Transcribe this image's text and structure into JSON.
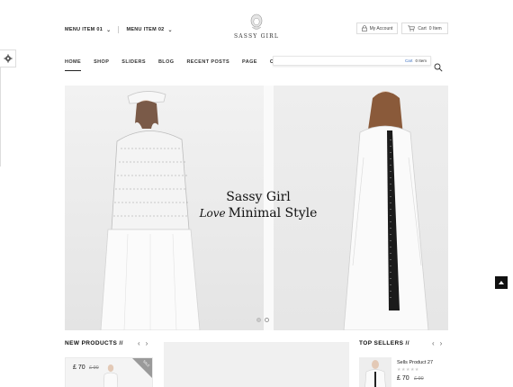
{
  "header": {
    "menu_items": [
      {
        "label": "MENU ITEM 01"
      },
      {
        "label": "MENU ITEM 02"
      }
    ],
    "logo_text": "SASSY GIRL",
    "account_label": "My Account",
    "cart_label": "Cart",
    "cart_count": "0 Item"
  },
  "nav": {
    "links": [
      {
        "label": "HOME",
        "active": true
      },
      {
        "label": "SHOP"
      },
      {
        "label": "SLIDERS"
      },
      {
        "label": "BLOG"
      },
      {
        "label": "RECENT POSTS"
      },
      {
        "label": "PAGE"
      },
      {
        "label": "CONTACT US"
      }
    ],
    "cart_dropdown": {
      "cart_word": "Cart",
      "count": "0 Item"
    }
  },
  "hero": {
    "line1": "Sassy Girl",
    "love": "Love",
    "line2": "Minimal Style",
    "slide_count": 2,
    "active_slide": 2
  },
  "new_products": {
    "title": "NEW PRODUCTS //",
    "items": [
      {
        "price": "£ 70",
        "old_price": "£ 90",
        "badge": "SALE"
      }
    ]
  },
  "top_sellers": {
    "title": "TOP SELLERS //",
    "items": [
      {
        "name": "Sells Product 27",
        "price": "£ 70",
        "old_price": "£ 90",
        "rating": 0
      }
    ]
  },
  "colors": {
    "accent": "#222222",
    "link": "#3a6fbf",
    "hero_bg": "#ececec"
  }
}
